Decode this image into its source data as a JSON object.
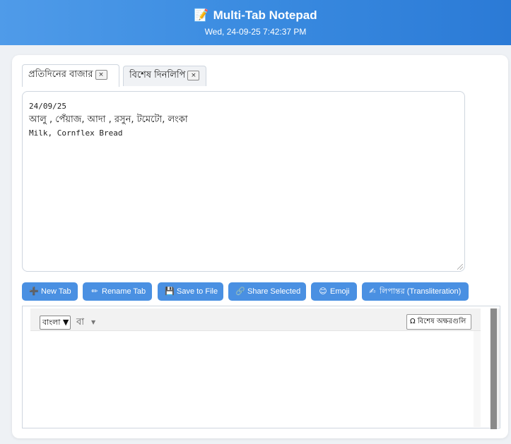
{
  "header": {
    "title": "Multi-Tab Notepad",
    "datetime": "Wed, 24-09-25 7:42:37 PM",
    "title_icon": "📝"
  },
  "tabs": [
    {
      "label": "প্রতিদিনের বাজার",
      "close": "×",
      "active": true
    },
    {
      "label": "বিশেষ দিনলিপি",
      "close": "×",
      "active": false
    }
  ],
  "editor": {
    "lines": [
      "24/09/25",
      "আলু , পেঁয়াজ, আদা , রসুন, টমেটো, লংকা",
      "Milk, Cornflex Bread"
    ]
  },
  "toolbar": {
    "new_tab": {
      "label": "New Tab",
      "icon": "➕"
    },
    "rename_tab": {
      "label": "Rename Tab",
      "icon": "✏"
    },
    "save_to_file": {
      "label": "Save to File",
      "icon": "💾"
    },
    "share_selected": {
      "label": "Share Selected",
      "icon": "🔗"
    },
    "emoji": {
      "label": "Emoji",
      "icon": "😊"
    },
    "transliteration": {
      "label": "লিপান্তর (Transliteration)",
      "icon": "✍"
    }
  },
  "keyboard": {
    "language_select": "বাংলা ▼",
    "script_label": "বা",
    "script_caret": "▼",
    "special_chars_button": "Ω বিশেষ অক্ষরগুলি"
  },
  "colors": {
    "accent": "#4a90e2",
    "header_gradient_start": "#4f9be9",
    "header_gradient_end": "#2b7ad6",
    "background": "#eef1f5"
  }
}
